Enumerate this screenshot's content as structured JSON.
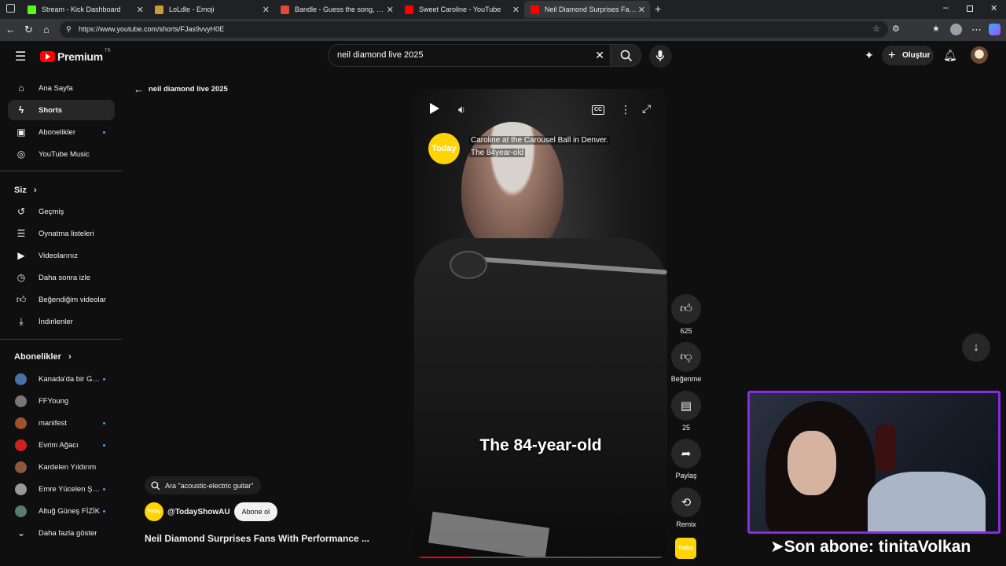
{
  "browser": {
    "tabs": [
      {
        "label": "Stream - Kick Dashboard",
        "favicon_color": "#53fc18"
      },
      {
        "label": "LoLdle - Emoji",
        "favicon_color": "#c89b3c"
      },
      {
        "label": "Bandle - Guess the song, on...",
        "favicon_color": "#e04a3b"
      },
      {
        "label": "Sweet Caroline - YouTube",
        "favicon_color": "#ff0000"
      },
      {
        "label": "Neil Diamond Surprises Fans With",
        "favicon_color": "#ff0000"
      }
    ],
    "url": "https://www.youtube.com/shorts/FJas9vvyH0E"
  },
  "youtube": {
    "logo_text": "Premium",
    "logo_region": "TR",
    "search_value": "neil diamond live 2025",
    "create_label": "Oluştur",
    "sidebar": {
      "main": [
        {
          "label": "Ana Sayfa",
          "icon": "home-icon"
        },
        {
          "label": "Shorts",
          "icon": "shorts-icon"
        },
        {
          "label": "Abonelikler",
          "icon": "subscriptions-icon"
        },
        {
          "label": "YouTube Music",
          "icon": "music-icon"
        }
      ],
      "you_heading": "Siz",
      "you": [
        {
          "label": "Geçmiş",
          "icon": "history-icon"
        },
        {
          "label": "Oynatma listeleri",
          "icon": "playlist-icon"
        },
        {
          "label": "Videolarınız",
          "icon": "video-icon"
        },
        {
          "label": "Daha sonra izle",
          "icon": "clock-icon"
        },
        {
          "label": "Beğendiğim videolar",
          "icon": "like-icon"
        },
        {
          "label": "İndirilenler",
          "icon": "download-icon"
        }
      ],
      "subs_heading": "Abonelikler",
      "subs": [
        {
          "label": "Kanada'da bir Ge...",
          "color": "#4a6fa5"
        },
        {
          "label": "FFYoung",
          "color": "#777777"
        },
        {
          "label": "manifest",
          "color": "#a0522d"
        },
        {
          "label": "Evrim Ağacı",
          "color": "#cc2222"
        },
        {
          "label": "Kardelen Yıldırım",
          "color": "#8b5a3c"
        },
        {
          "label": "Emre Yücelen Şa...",
          "color": "#999999"
        },
        {
          "label": "Altuğ Güneş FİZİK",
          "color": "#5a7a6a"
        },
        {
          "label": "Daha fazla göster",
          "color": ""
        }
      ]
    },
    "back_label": "neil diamond live 2025",
    "short": {
      "caption": "Caroline at the Carousel Ball in Denver.",
      "caption2": "The 84year-old",
      "subtitle": "The 84-year-old",
      "channel_logo": "Today",
      "search_chip": "Ara \"acoustic-electric guitar\"",
      "channel": "@TodayShowAU",
      "subscribe_label": "Abone ol",
      "title": "Neil Diamond Surprises Fans With Performance ..."
    },
    "actions": {
      "likes": "625",
      "dislike": "Beğenme",
      "comments": "25",
      "share": "Paylaş",
      "remix": "Remix"
    }
  },
  "overlay": {
    "sub_text": "➤Son abone: tinitaVolkan",
    "border_color": "#8a2be2"
  }
}
